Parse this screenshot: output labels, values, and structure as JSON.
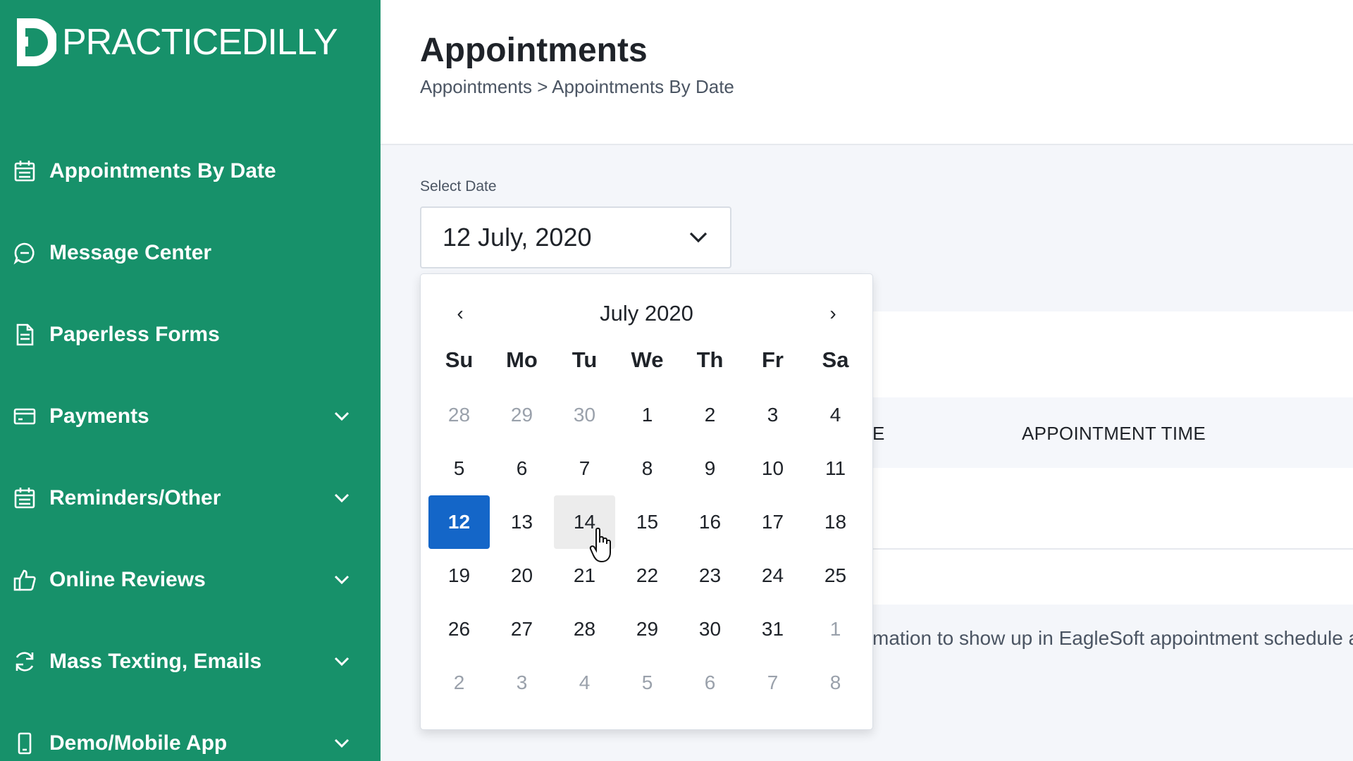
{
  "brand": {
    "name": "PRACTICEDILLY"
  },
  "sidebar": {
    "items": [
      {
        "label": "Appointments By Date",
        "icon": "calendar-icon",
        "has_submenu": false
      },
      {
        "label": "Message Center",
        "icon": "chat-bubble-icon",
        "has_submenu": false
      },
      {
        "label": "Paperless Forms",
        "icon": "document-icon",
        "has_submenu": false
      },
      {
        "label": "Payments",
        "icon": "credit-card-icon",
        "has_submenu": true
      },
      {
        "label": "Reminders/Other",
        "icon": "calendar-icon",
        "has_submenu": true
      },
      {
        "label": "Online Reviews",
        "icon": "thumbs-up-icon",
        "has_submenu": true
      },
      {
        "label": "Mass Texting, Emails",
        "icon": "refresh-icon",
        "has_submenu": true
      },
      {
        "label": "Demo/Mobile App",
        "icon": "mobile-phone-icon",
        "has_submenu": true
      }
    ]
  },
  "header": {
    "title": "Appointments",
    "breadcrumb": "Appointments > Appointments By Date"
  },
  "date_picker": {
    "label": "Select Date",
    "value": "12 July, 2020"
  },
  "calendar": {
    "title": "July 2020",
    "prev": "‹",
    "next": "›",
    "weekdays": [
      "Su",
      "Mo",
      "Tu",
      "We",
      "Th",
      "Fr",
      "Sa"
    ],
    "days": [
      {
        "n": "28",
        "muted": true
      },
      {
        "n": "29",
        "muted": true
      },
      {
        "n": "30",
        "muted": true
      },
      {
        "n": "1"
      },
      {
        "n": "2"
      },
      {
        "n": "3"
      },
      {
        "n": "4"
      },
      {
        "n": "5"
      },
      {
        "n": "6"
      },
      {
        "n": "7"
      },
      {
        "n": "8"
      },
      {
        "n": "9"
      },
      {
        "n": "10"
      },
      {
        "n": "11"
      },
      {
        "n": "12",
        "selected": true
      },
      {
        "n": "13"
      },
      {
        "n": "14",
        "hovered": true
      },
      {
        "n": "15"
      },
      {
        "n": "16"
      },
      {
        "n": "17"
      },
      {
        "n": "18"
      },
      {
        "n": "19"
      },
      {
        "n": "20"
      },
      {
        "n": "21"
      },
      {
        "n": "22"
      },
      {
        "n": "23"
      },
      {
        "n": "24"
      },
      {
        "n": "25"
      },
      {
        "n": "26"
      },
      {
        "n": "27"
      },
      {
        "n": "28"
      },
      {
        "n": "29"
      },
      {
        "n": "30"
      },
      {
        "n": "31"
      },
      {
        "n": "1",
        "muted": true
      },
      {
        "n": "2",
        "muted": true
      },
      {
        "n": "3",
        "muted": true
      },
      {
        "n": "4",
        "muted": true
      },
      {
        "n": "5",
        "muted": true
      },
      {
        "n": "6",
        "muted": true
      },
      {
        "n": "7",
        "muted": true
      },
      {
        "n": "8",
        "muted": true
      }
    ]
  },
  "table": {
    "partial_header": "E",
    "time_header": "APPOINTMENT TIME"
  },
  "note": "mation to show up in EagleSoft appointment schedule a",
  "colors": {
    "sidebar": "#17916a",
    "selected_day": "#1466c8",
    "hover_day": "#ececec"
  }
}
